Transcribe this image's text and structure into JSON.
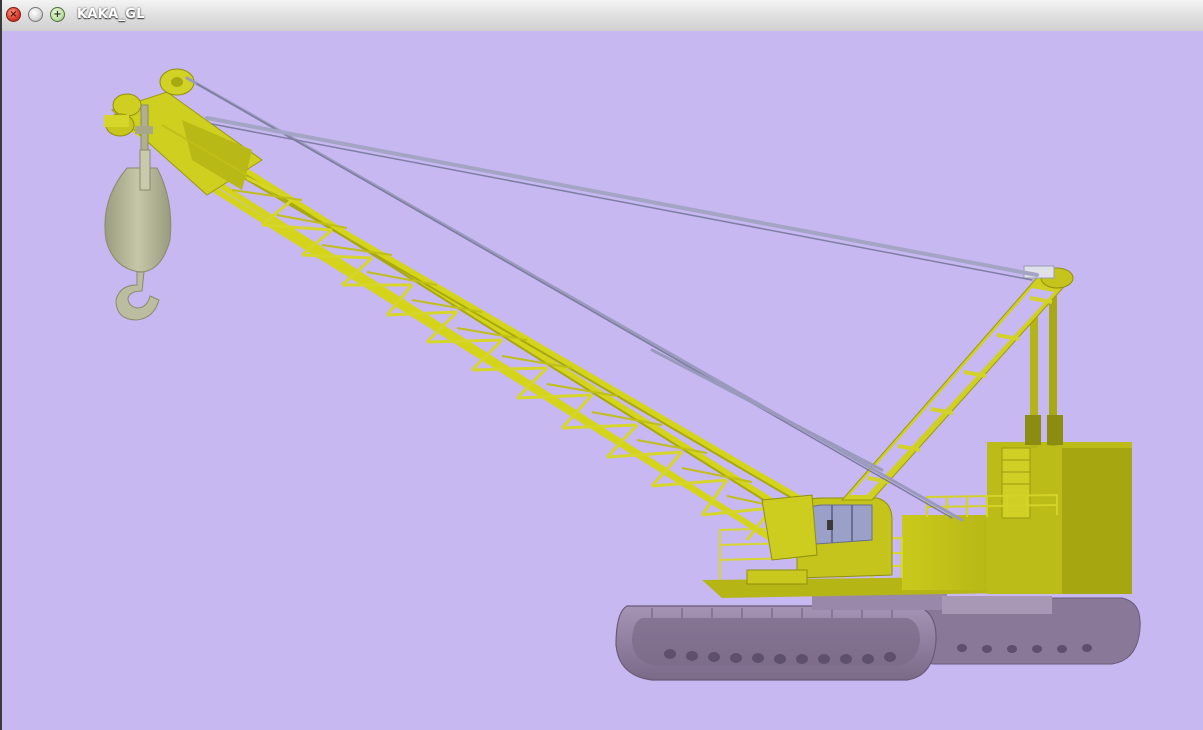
{
  "window": {
    "title": "KAKA_GL",
    "buttons": {
      "close": {
        "icon": "close-icon",
        "glyph": "×",
        "color": "#d83a2a"
      },
      "minimize": {
        "icon": "minimize-icon",
        "glyph": "",
        "color": "#d8d8d8"
      },
      "maximize": {
        "icon": "maximize-icon",
        "glyph": "+",
        "color": "#bfe0a6"
      }
    }
  },
  "viewport": {
    "background_color": "#c8b8f2",
    "scene": "crawler-crane-3d-model",
    "colors": {
      "crane_body": "#c8c81e",
      "boom_lattice": "#d4d41a",
      "cables": "#9a9ab8",
      "hook": "#b8b89a",
      "tracks": "#8e7a9c"
    }
  }
}
